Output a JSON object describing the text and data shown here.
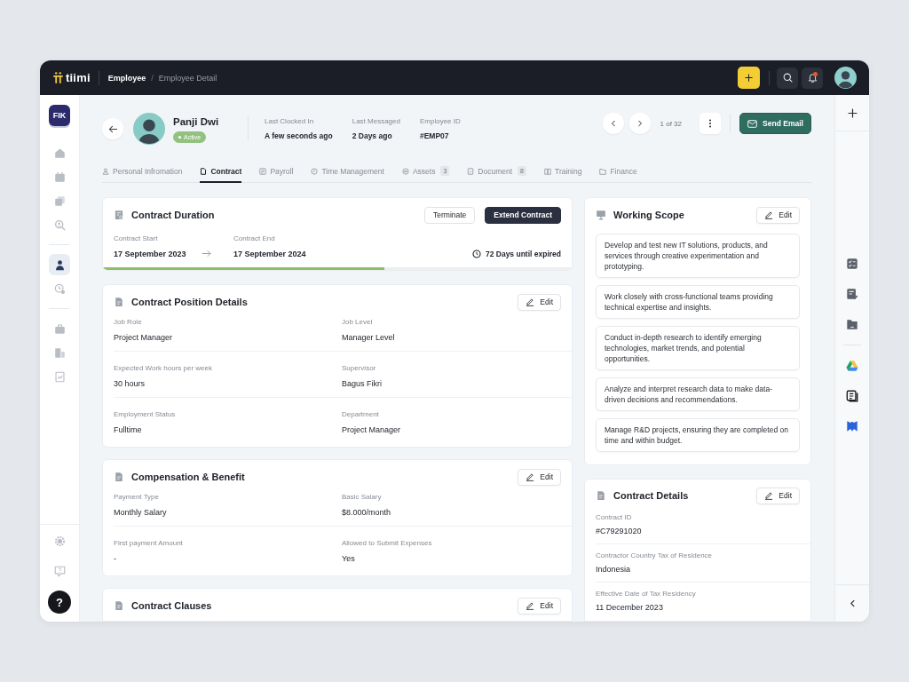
{
  "app": {
    "brand": "tiimi",
    "breadcrumb": {
      "items": [
        "Employee",
        "Employee Detail"
      ],
      "separator": "/"
    },
    "notifications": {
      "unread": true
    }
  },
  "sidebar": {
    "workspace": "FIK",
    "groups": [
      {
        "items": [
          {
            "selected": false
          },
          {
            "selected": false
          },
          {
            "selected": false
          },
          {
            "selected": false
          }
        ]
      },
      {
        "items": [
          {
            "selected": true
          },
          {
            "selected": false
          }
        ]
      },
      {
        "items": [
          {
            "selected": false
          },
          {
            "selected": false
          },
          {
            "selected": false
          }
        ]
      }
    ],
    "help": "?"
  },
  "profile": {
    "name": "Panji Dwi",
    "status": "Active",
    "info": [
      {
        "label": "Last Clocked In",
        "value": "A few seconds ago"
      },
      {
        "label": "Last Messaged",
        "value": "2 Days ago"
      },
      {
        "label": "Employee ID",
        "value": "#EMP07"
      }
    ],
    "pager": "1 of 32",
    "send_button": "Send Email"
  },
  "tabs": [
    {
      "label": "Personal Infromation",
      "selected": false
    },
    {
      "label": "Contract",
      "selected": true
    },
    {
      "label": "Payroll",
      "selected": false
    },
    {
      "label": "Time Management",
      "selected": false
    },
    {
      "label": "Assets",
      "count": "3",
      "selected": false
    },
    {
      "label": "Document",
      "count": "8",
      "selected": false
    },
    {
      "label": "Training",
      "selected": false
    },
    {
      "label": "Finance",
      "selected": false
    }
  ],
  "contract_duration": {
    "title": "Contract Duration",
    "buttons": [
      {
        "label": "Terminate",
        "kind": "secondary"
      },
      {
        "label": "Extend Contract",
        "kind": "primary"
      }
    ],
    "start": {
      "label": "Contract Start",
      "value": "17 September 2023"
    },
    "end": {
      "label": "Contract End",
      "value": "17 September 2024"
    },
    "remaining": "72 Days until expired",
    "level": 0.6
  },
  "sections": [
    {
      "title": "Contract Position Details",
      "edit": "Edit",
      "fields": [
        {
          "label": "Job Role",
          "value": "Project Manager"
        },
        {
          "label": "Job Level",
          "value": "Manager Level"
        },
        {
          "label": "Expected Work hours per week",
          "value": "30 hours"
        },
        {
          "label": "Supervisor",
          "value": "Bagus Fikri"
        },
        {
          "label": "Employment Status",
          "value": "Fulltime"
        },
        {
          "label": "Department",
          "value": "Project Manager"
        }
      ]
    },
    {
      "title": "Compensation & Benefit",
      "edit": "Edit",
      "fields": [
        {
          "label": "Payment Type",
          "value": "Monthly Salary"
        },
        {
          "label": "Basic Salary",
          "value": "$8.000/month"
        },
        {
          "label": "First payment Amount",
          "value": "-"
        },
        {
          "label": "Allowed to Submit Expenses",
          "value": "Yes"
        }
      ]
    },
    {
      "title": "Contract Clauses",
      "edit": "Edit"
    }
  ],
  "working_scope": {
    "title": "Working Scope",
    "edit": "Edit",
    "items": [
      "Develop and test new IT solutions, products, and services through creative experimentation and prototyping.",
      "Work closely with cross-functional teams providing technical expertise and insights.",
      "Conduct in-depth research to identify emerging technologies, market trends, and potential opportunities.",
      "Analyze and interpret research data to make data-driven decisions and recommendations.",
      "Manage R&D projects, ensuring they are completed on time and within budget."
    ]
  },
  "contract_details": {
    "title": "Contract Details",
    "edit": "Edit",
    "fields": [
      {
        "label": "Contract ID",
        "value": "#C79291020"
      },
      {
        "label": "Contractor Country Tax of Residence",
        "value": "Indonesia"
      },
      {
        "label": "Effective Date of Tax Residency",
        "value": "11 December 2023"
      }
    ]
  }
}
